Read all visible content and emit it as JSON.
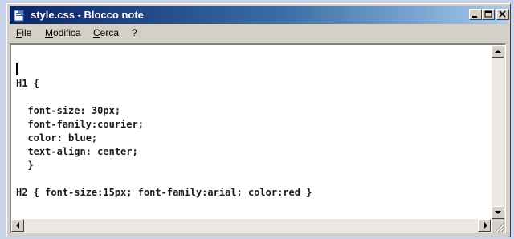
{
  "window": {
    "title": "style.css - Blocco note",
    "icon": "notepad-icon"
  },
  "caption_buttons": [
    {
      "name": "minimize-button",
      "icon": "minimize-icon"
    },
    {
      "name": "maximize-button",
      "icon": "maximize-icon"
    },
    {
      "name": "close-button",
      "icon": "close-icon"
    }
  ],
  "menu": {
    "items": [
      "File",
      "Modifica",
      "Cerca",
      "?"
    ]
  },
  "editor": {
    "lines": [
      "",
      "H1 {",
      "",
      "  font-size: 30px;",
      "  font-family:courier;",
      "  color: blue;",
      "  text-align: center;",
      "  }",
      "",
      "H2 { font-size:15px; font-family:arial; color:red }"
    ]
  },
  "colors": {
    "titlebar_start": "#0a246a",
    "titlebar_end": "#a6caf0",
    "window_face": "#d4d0c8",
    "desktop": "#c9d3ea"
  }
}
